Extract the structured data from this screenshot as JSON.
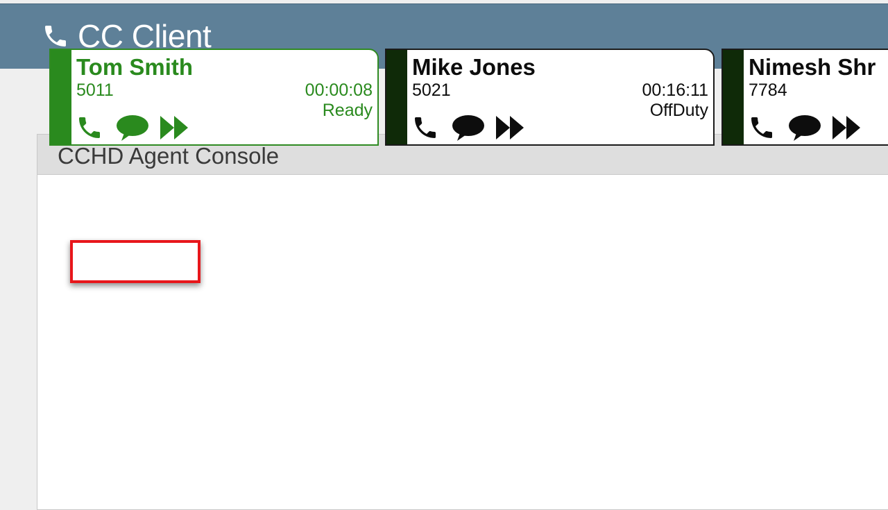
{
  "app": {
    "title": "CC Client",
    "icon": "phone-icon",
    "header_color": "#5e8098"
  },
  "console": {
    "title": "CCHD Agent Console"
  },
  "agents": [
    {
      "name": "Tom Smith",
      "extension": "5011",
      "timer": "00:00:08",
      "status": "Ready",
      "active": true,
      "color": "#2a8a1e"
    },
    {
      "name": "Mike Jones",
      "extension": "5021",
      "timer": "00:16:11",
      "status": "OffDuty",
      "active": false,
      "color": "#0d0d0d"
    },
    {
      "name": "Nimesh Shr",
      "extension": "7784",
      "timer": "",
      "status": "",
      "active": false,
      "color": "#0d0d0d"
    }
  ],
  "actions": [
    "phone-icon",
    "chat-bubble-icon",
    "fast-forward-icon"
  ],
  "annotation": {
    "highlight_color": "#e8161b"
  }
}
